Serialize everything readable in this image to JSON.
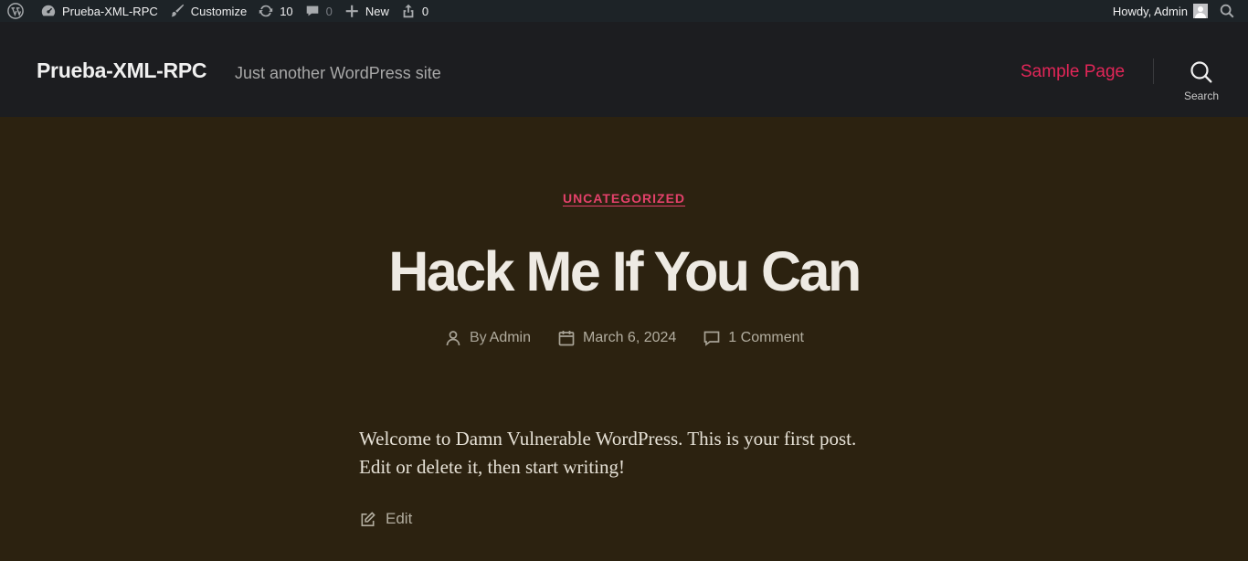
{
  "admin_bar": {
    "site_name": "Prueba-XML-RPC",
    "customize": "Customize",
    "updates_count": "10",
    "comments_count": "0",
    "new": "New",
    "share_count": "0",
    "greeting": "Howdy, Admin"
  },
  "header": {
    "site_title": "Prueba-XML-RPC",
    "tagline": "Just another WordPress site",
    "nav": [
      {
        "label": "Sample Page"
      }
    ],
    "search_label": "Search"
  },
  "post": {
    "category": "UNCATEGORIZED",
    "title": "Hack Me If You Can",
    "author_prefix": "By",
    "author": "Admin",
    "date": "March 6, 2024",
    "comments": "1 Comment",
    "body": "Welcome to Damn Vulnerable WordPress. This is your first post. Edit or delete it, then start writing!",
    "edit_label": "Edit"
  },
  "colors": {
    "accent": "#e22658",
    "background": "#2c2210",
    "header_bg": "#1c1d20",
    "admin_bar_bg": "#1d2327"
  }
}
